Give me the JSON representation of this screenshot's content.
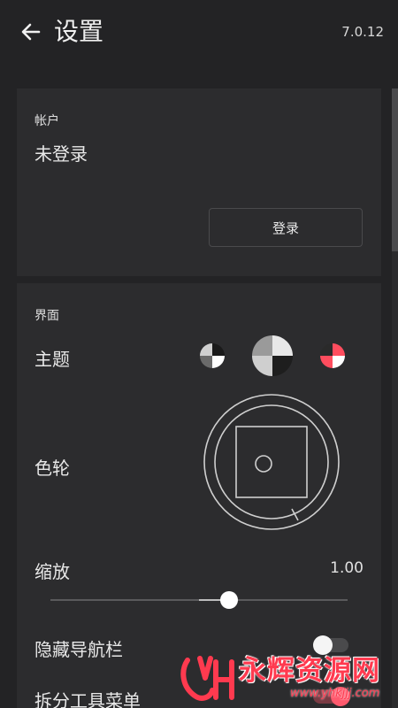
{
  "header": {
    "title": "设置",
    "version": "7.0.12",
    "back_icon": "arrow-left-icon"
  },
  "account": {
    "section_label": "帐户",
    "status": "未登录",
    "login_button": "登录"
  },
  "interface": {
    "section_label": "界面",
    "theme_label": "主题",
    "themes": [
      {
        "name": "dark-gray-theme",
        "colors": [
          "#6b6b6b",
          "#1c1c1c",
          "#ffffff"
        ]
      },
      {
        "name": "light-gray-theme",
        "colors": [
          "#dcdcdc",
          "#8a8a8a",
          "#2a2a2a"
        ],
        "selected": true
      },
      {
        "name": "red-theme",
        "colors": [
          "#ff4d5e",
          "#ffffff",
          "#222222"
        ]
      }
    ],
    "color_wheel_label": "色轮",
    "zoom_label": "缩放",
    "zoom_value": "1.00",
    "zoom_slider_fraction": 0.6,
    "hide_nav_label": "隐藏导航栏",
    "hide_nav_enabled": false,
    "split_toolbar_label": "拆分工具菜单",
    "split_toolbar_enabled": true
  },
  "watermark": {
    "text": "永辉资源网",
    "url": "www.yhkjjj.com"
  },
  "colors": {
    "background": "#232325",
    "card": "#2c2c2e",
    "accent": "#ff5a6e"
  }
}
